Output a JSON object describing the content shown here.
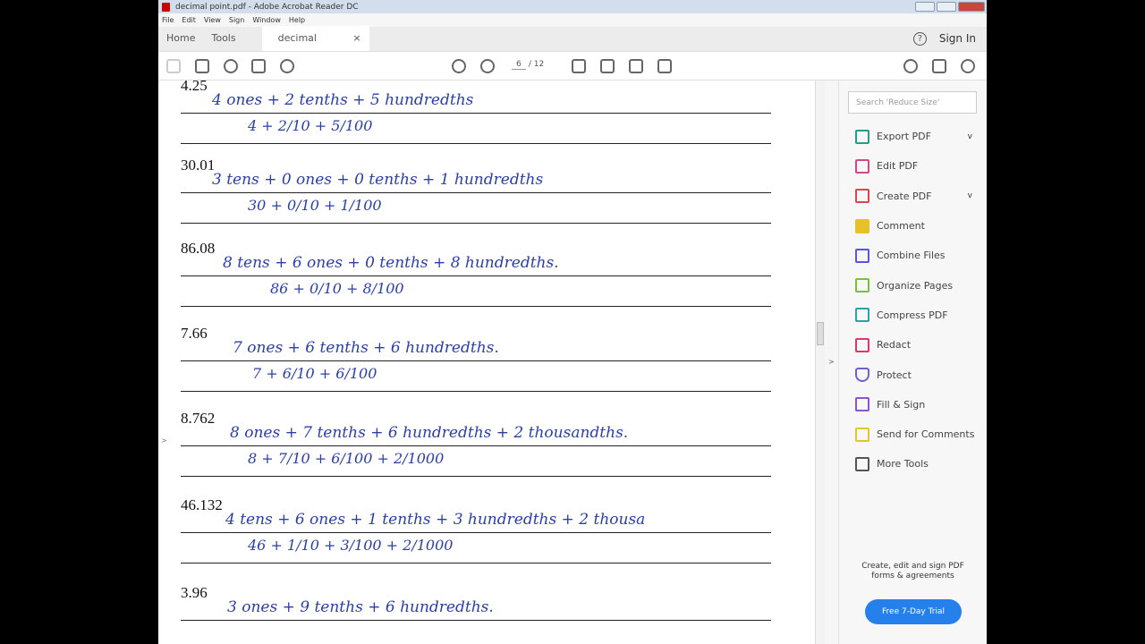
{
  "window": {
    "title": "decimal point.pdf - Adobe Acrobat Reader DC"
  },
  "menu": [
    "File",
    "Edit",
    "View",
    "Sign",
    "Window",
    "Help"
  ],
  "tabs": {
    "home": "Home",
    "tools": "Tools",
    "doc": "decimal point.pdf",
    "close": "×",
    "sign_in": "Sign In",
    "help": "?"
  },
  "toolbar": {
    "current_page": "6",
    "total_pages": "/ 12"
  },
  "document": {
    "entries": [
      {
        "number": "4.25",
        "line1": "4 ones + 2 tenths + 5 hundredths",
        "line2": "4 + 2/10 + 5/100"
      },
      {
        "number": "30.01",
        "line1": "3 tens + 0 ones + 0 tenths + 1 hundredths",
        "line2": "30 + 0/10 + 1/100"
      },
      {
        "number": "86.08",
        "line1": "8 tens + 6 ones + 0 tenths + 8 hundredths.",
        "line2": "86 + 0/10 + 8/100"
      },
      {
        "number": "7.66",
        "line1": "7 ones + 6 tenths + 6 hundredths.",
        "line2": "7 + 6/10 + 6/100"
      },
      {
        "number": "8.762",
        "line1": "8 ones + 7 tenths + 6 hundredths + 2 thousandths.",
        "line2": "8 + 7/10 + 6/100 + 2/1000"
      },
      {
        "number": "46.132",
        "line1": "4 tens + 6 ones + 1 tenths + 3 hundredths + 2 thousa",
        "line2": "46 + 1/10 + 3/100 + 2/1000"
      },
      {
        "number": "3.96",
        "line1": "3 ones + 9 tenths + 6 hundredths.",
        "line2": ""
      }
    ]
  },
  "panel": {
    "search_placeholder": "Search 'Reduce Size'",
    "tools": [
      {
        "label": "Export PDF",
        "color": "#2b9a8a",
        "chevron": true
      },
      {
        "label": "Edit PDF",
        "color": "#d04a8a",
        "chevron": false
      },
      {
        "label": "Create PDF",
        "color": "#d9464b",
        "chevron": true
      },
      {
        "label": "Comment",
        "color": "#e8c12a",
        "chevron": false
      },
      {
        "label": "Combine Files",
        "color": "#5b57d6",
        "chevron": false
      },
      {
        "label": "Organize Pages",
        "color": "#7bbf3a",
        "chevron": false
      },
      {
        "label": "Compress PDF",
        "color": "#2aa2a8",
        "chevron": false
      },
      {
        "label": "Redact",
        "color": "#d63a6e",
        "chevron": false
      },
      {
        "label": "Protect",
        "color": "#6c63c9",
        "chevron": false
      },
      {
        "label": "Fill & Sign",
        "color": "#8a55c9",
        "chevron": false
      },
      {
        "label": "Send for Comments",
        "color": "#e6c52b",
        "chevron": false
      },
      {
        "label": "More Tools",
        "color": "#555555",
        "chevron": false
      }
    ],
    "promo": "Create, edit and sign PDF forms & agreements",
    "trial_button": "Free 7-Day Trial"
  }
}
